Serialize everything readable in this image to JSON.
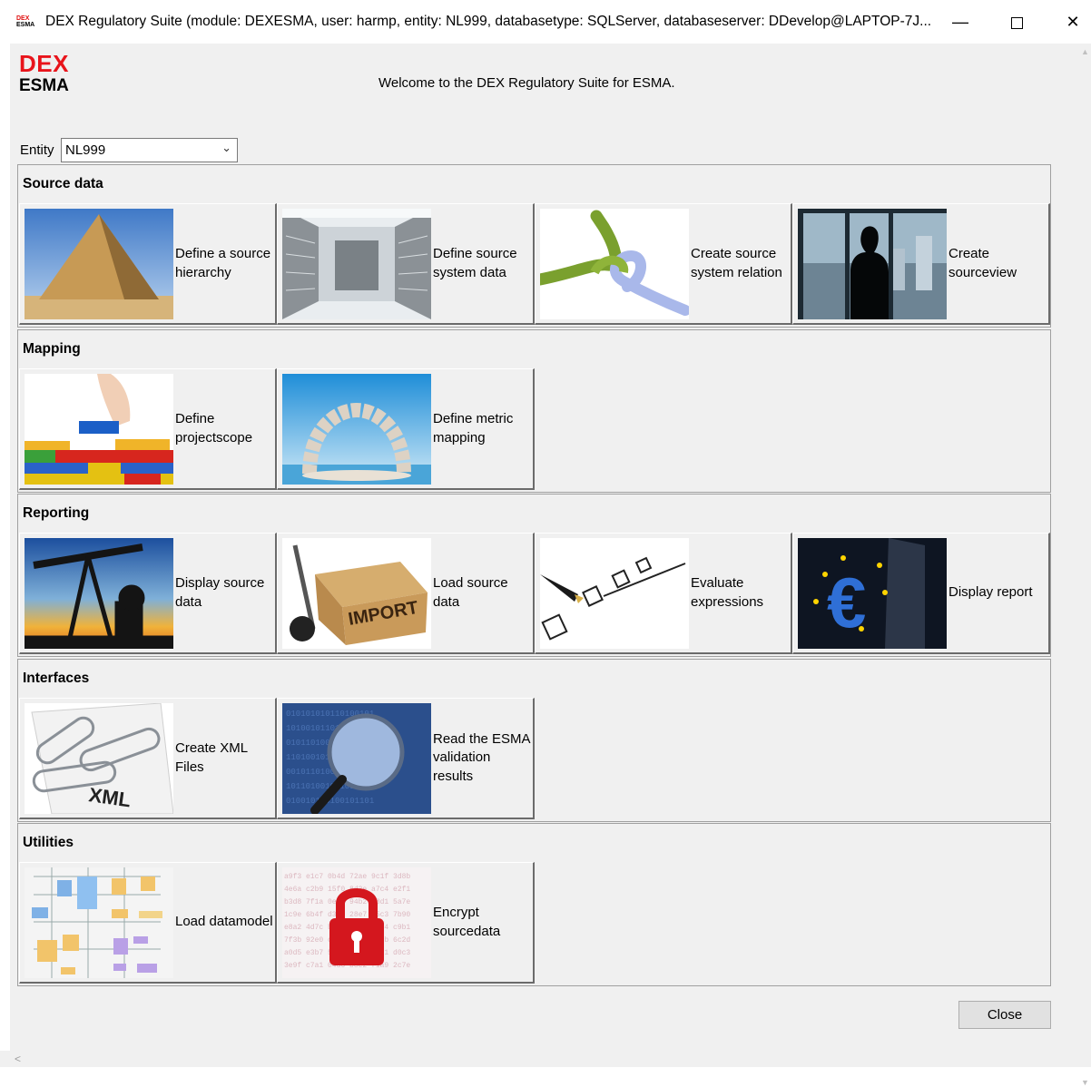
{
  "window": {
    "icon_top": "DEX",
    "icon_bottom": "ESMA",
    "title": "DEX Regulatory Suite (module: DEXESMA, user: harmp, entity: NL999, databasetype: SQLServer, databaseserver: DDevelop@LAPTOP-7J...",
    "minimize": "—",
    "close": "✕"
  },
  "logo": {
    "line1": "DEX",
    "line2": "ESMA"
  },
  "welcome": "Welcome to the DEX Regulatory Suite for ESMA.",
  "entity": {
    "label": "Entity",
    "value": "NL999"
  },
  "sections": {
    "source": {
      "title": "Source data",
      "tiles": [
        {
          "label": "Define a source hierarchy",
          "image": "pyramid-image"
        },
        {
          "label": "Define source system data",
          "image": "server-room-image"
        },
        {
          "label": "Create source system relation",
          "image": "knot-image"
        },
        {
          "label": "Create sourceview",
          "image": "man-at-window-image"
        }
      ]
    },
    "mapping": {
      "title": "Mapping",
      "tiles": [
        {
          "label": "Define projectscope",
          "image": "lego-blocks-image"
        },
        {
          "label": "Define metric mapping",
          "image": "stone-arch-image"
        }
      ]
    },
    "reporting": {
      "title": "Reporting",
      "tiles": [
        {
          "label": "Display source data",
          "image": "oil-pump-image"
        },
        {
          "label": "Load source data",
          "image": "import-box-image"
        },
        {
          "label": "Evaluate expressions",
          "image": "checkboxes-image"
        },
        {
          "label": "Display report",
          "image": "euro-sign-image"
        }
      ]
    },
    "interfaces": {
      "title": "Interfaces",
      "tiles": [
        {
          "label": "Create XML Files",
          "image": "xml-paperclip-image"
        },
        {
          "label": "Read the ESMA validation results",
          "image": "magnifier-image"
        }
      ]
    },
    "utilities": {
      "title": "Utilities",
      "tiles": [
        {
          "label": "Load datamodel",
          "image": "datamodel-diagram-image"
        },
        {
          "label": "Encrypt sourcedata",
          "image": "padlock-image"
        }
      ]
    }
  },
  "close_label": "Close",
  "colors": {
    "brand_red": "#e8141b",
    "panel": "#f0f0f0"
  }
}
